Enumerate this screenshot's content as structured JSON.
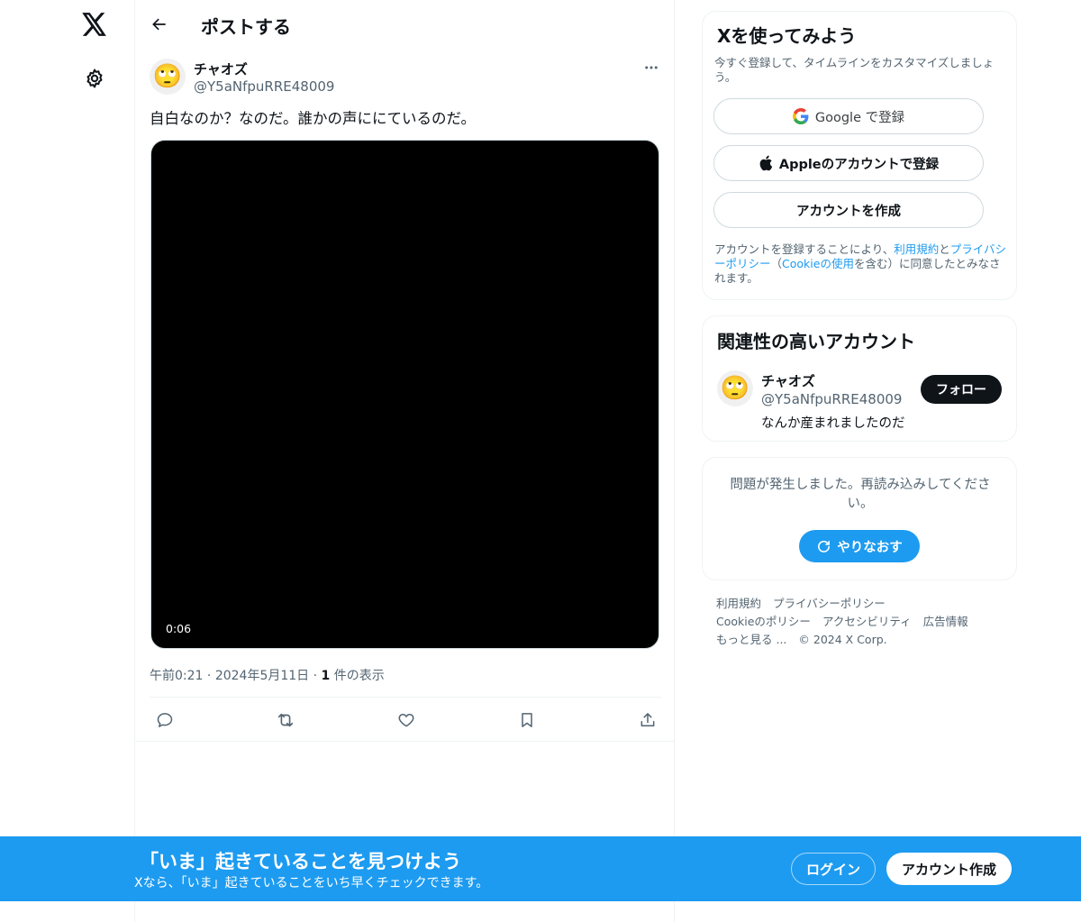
{
  "nav": {
    "logo_icon": "x-logo-icon",
    "settings_icon": "gear-icon"
  },
  "header": {
    "title": "ポストする"
  },
  "post": {
    "author_name": "チャオズ",
    "author_handle": "@Y5aNfpuRRE48009",
    "avatar_emoji": "🙄",
    "text": "自白なのか？なのだ。誰かの声ににているのだ。",
    "video_duration": "0:06",
    "time": "午前0:21",
    "date": "2024年5月11日",
    "sep": "·",
    "view_count": "1",
    "view_label": " 件の表示"
  },
  "signup": {
    "title": "Xを使ってみよう",
    "subtitle": "今すぐ登録して、タイムラインをカスタマイズしましょう。",
    "google_label": "Google で登録",
    "apple_label": "Appleのアカウントで登録",
    "create_label": "アカウントを作成",
    "legal_1": "アカウントを登録することにより、",
    "legal_terms": "利用規約",
    "legal_2": "と",
    "legal_privacy": "プライバシーポリシー",
    "legal_3": "（",
    "legal_cookie": "Cookieの使用",
    "legal_4": "を含む）に同意したとみなされます。"
  },
  "suggest": {
    "title": "関連性の高いアカウント",
    "name": "チャオズ",
    "handle": "@Y5aNfpuRRE48009",
    "bio": "なんか産まれましたのだ",
    "follow_label": "フォロー",
    "avatar_emoji": "🙄"
  },
  "error": {
    "message": "問題が発生しました。再読み込みしてください。",
    "retry_label": "やりなおす"
  },
  "footer": {
    "row1": [
      "利用規約",
      "プライバシーポリシー"
    ],
    "row2": [
      "Cookieのポリシー",
      "アクセシビリティ",
      "広告情報"
    ],
    "more": "もっと見る ...",
    "copyright": "© 2024 X Corp."
  },
  "banner": {
    "title": "「いま」起きていることを見つけよう",
    "subtitle": "Xなら、「いま」起きていることをいち早くチェックできます。",
    "login_label": "ログイン",
    "signup_label": "アカウント作成"
  },
  "colors": {
    "accent": "#1d9bf0",
    "text": "#0f1419",
    "muted": "#536471"
  }
}
